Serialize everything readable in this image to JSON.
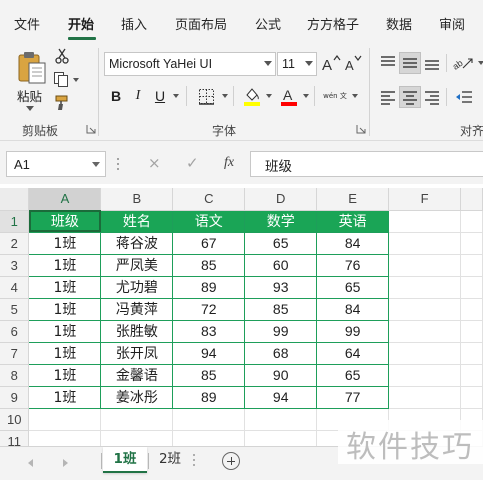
{
  "ribbon_tabs": [
    {
      "label": "文件",
      "active": false
    },
    {
      "label": "开始",
      "active": true
    },
    {
      "label": "插入",
      "active": false
    },
    {
      "label": "页面布局",
      "active": false
    },
    {
      "label": "公式",
      "active": false
    },
    {
      "label": "方方格子",
      "active": false
    },
    {
      "label": "数据",
      "active": false
    },
    {
      "label": "审阅",
      "active": false
    }
  ],
  "ribbon": {
    "clipboard": {
      "paste_label": "粘贴",
      "group_label": "剪贴板",
      "icons": [
        "paste-icon",
        "cut-icon",
        "copy-icon",
        "format-painter-icon"
      ]
    },
    "font": {
      "font_name": "Microsoft YaHei UI",
      "font_size": "11",
      "bold_label": "B",
      "italic_label": "I",
      "underline_label": "U",
      "phonetic_label": "wén 文",
      "group_label": "字体",
      "fill_color": "#ffff00",
      "font_color": "#ff0000"
    },
    "alignment": {
      "group_label": "对齐"
    }
  },
  "formula_bar": {
    "name_box": "A1",
    "cancel_icon": "×",
    "enter_icon": "✓",
    "fx_label": "fx",
    "content": "班级"
  },
  "grid": {
    "columns": [
      "A",
      "B",
      "C",
      "D",
      "E",
      "F"
    ],
    "rows": [
      "1",
      "2",
      "3",
      "4",
      "5",
      "6",
      "7",
      "8",
      "9",
      "10",
      "11"
    ],
    "selected_cell": "A1",
    "header_fill": "#1aa556",
    "border_color": "#1e9e5a",
    "table": {
      "headers": [
        "班级",
        "姓名",
        "语文",
        "数学",
        "英语"
      ],
      "rows": [
        [
          "1班",
          "蒋谷波",
          "67",
          "65",
          "84"
        ],
        [
          "1班",
          "严凤美",
          "85",
          "60",
          "76"
        ],
        [
          "1班",
          "尤功碧",
          "89",
          "93",
          "65"
        ],
        [
          "1班",
          "冯黄萍",
          "72",
          "85",
          "84"
        ],
        [
          "1班",
          "张胜敏",
          "83",
          "99",
          "99"
        ],
        [
          "1班",
          "张开凤",
          "94",
          "68",
          "64"
        ],
        [
          "1班",
          "金馨语",
          "85",
          "90",
          "65"
        ],
        [
          "1班",
          "姜冰彤",
          "89",
          "94",
          "77"
        ]
      ]
    }
  },
  "sheets": {
    "tabs": [
      {
        "label": "1班",
        "active": true
      },
      {
        "label": "2班",
        "active": false
      }
    ],
    "add_icon": "add-sheet-icon"
  },
  "watermark": "软件技巧"
}
